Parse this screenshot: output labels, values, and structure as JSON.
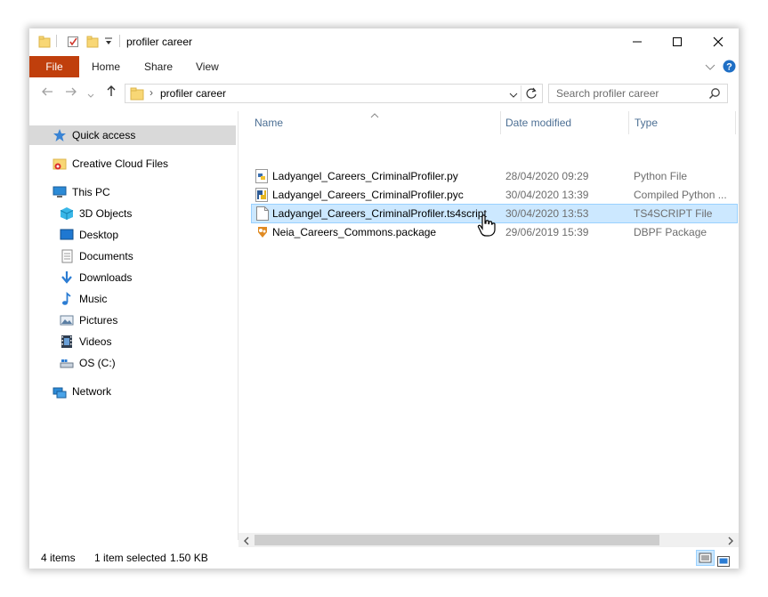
{
  "titlebar": {
    "title": "profiler career",
    "minimize_icon": "minimize-icon",
    "maximize_icon": "maximize-icon",
    "close_icon": "close-icon"
  },
  "ribbon": {
    "file": "File",
    "home": "Home",
    "share": "Share",
    "view": "View",
    "file_tab_color": "#c03f0c"
  },
  "address": {
    "path": "profiler career",
    "separator": "›",
    "search_placeholder": "Search profiler career"
  },
  "sidebar": {
    "items": [
      {
        "label": "Quick access",
        "icon": "star-icon"
      },
      {
        "label": "Creative Cloud Files",
        "icon": "creative-cloud-icon"
      },
      {
        "label": "This PC",
        "icon": "computer-icon"
      },
      {
        "label": "3D Objects",
        "icon": "cube-icon"
      },
      {
        "label": "Desktop",
        "icon": "desktop-icon"
      },
      {
        "label": "Documents",
        "icon": "documents-icon"
      },
      {
        "label": "Downloads",
        "icon": "download-arrow-icon"
      },
      {
        "label": "Music",
        "icon": "music-note-icon"
      },
      {
        "label": "Pictures",
        "icon": "pictures-icon"
      },
      {
        "label": "Videos",
        "icon": "videos-icon"
      },
      {
        "label": "OS (C:)",
        "icon": "drive-icon"
      },
      {
        "label": "Network",
        "icon": "network-icon"
      }
    ]
  },
  "columns": {
    "name": "Name",
    "date_modified": "Date modified",
    "type": "Type"
  },
  "files": [
    {
      "name": "Ladyangel_Careers_CriminalProfiler.py",
      "date": "28/04/2020 09:29",
      "type": "Python File",
      "icon": "python-file-icon"
    },
    {
      "name": "Ladyangel_Careers_CriminalProfiler.pyc",
      "date": "30/04/2020 13:39",
      "type": "Compiled Python ...",
      "icon": "compiled-python-icon"
    },
    {
      "name": "Ladyangel_Careers_CriminalProfiler.ts4script",
      "date": "30/04/2020 13:53",
      "type": "TS4SCRIPT File",
      "icon": "blank-file-icon"
    },
    {
      "name": "Neia_Careers_Commons.package",
      "date": "29/06/2019 15:39",
      "type": "DBPF Package",
      "icon": "package-icon"
    }
  ],
  "status": {
    "count": "4 items",
    "selected": "1 item selected",
    "size": "1.50 KB"
  },
  "accent_color": "#cce8ff",
  "link_color": "#4c6f94"
}
